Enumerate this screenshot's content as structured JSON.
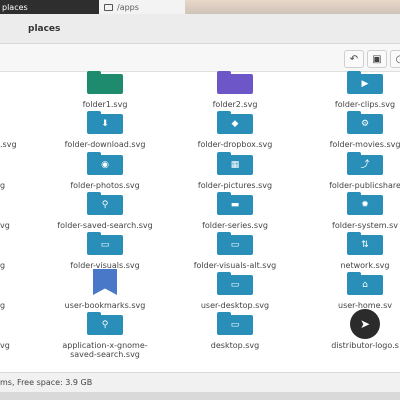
{
  "tabs": [
    {
      "label": "places"
    },
    {
      "label": "/apps"
    }
  ],
  "header": {
    "title": "places"
  },
  "toolbar": {
    "undo_icon": "undo-icon",
    "image_icon": "image-icon",
    "more_icon": "more-icon"
  },
  "items": [
    {
      "label": "folder1.svg",
      "icon": "folder-icon",
      "color": "#1e8a6e"
    },
    {
      "label": "folder2.svg",
      "icon": "folder-icon",
      "color": "#6d56c8"
    },
    {
      "label": "folder-clips.svg",
      "icon": "video-icon",
      "color": "#2a8fb8"
    },
    {
      "label": "folder-download.svg",
      "icon": "download-icon",
      "color": "#2a8fb8"
    },
    {
      "label": "folder-dropbox.svg",
      "icon": "dropbox-icon",
      "color": "#2a8fb8"
    },
    {
      "label": "folder-movies.svg",
      "icon": "film-icon",
      "color": "#2a8fb8"
    },
    {
      "label": "folder-photos.svg",
      "icon": "camera-icon",
      "color": "#2a8fb8"
    },
    {
      "label": "folder-pictures.svg",
      "icon": "picture-icon",
      "color": "#2a8fb8"
    },
    {
      "label": "folder-publicshare",
      "icon": "share-icon",
      "color": "#2a8fb8"
    },
    {
      "label": "folder-saved-search.svg",
      "icon": "search-icon",
      "color": "#2a8fb8"
    },
    {
      "label": "folder-series.svg",
      "icon": "series-icon",
      "color": "#2a8fb8"
    },
    {
      "label": "folder-system.sv",
      "icon": "gear-icon",
      "color": "#2a8fb8"
    },
    {
      "label": "folder-visuals.svg",
      "icon": "visuals-icon",
      "color": "#2a8fb8"
    },
    {
      "label": "folder-visuals-alt.svg",
      "icon": "visuals-alt-icon",
      "color": "#2a8fb8"
    },
    {
      "label": "network.svg",
      "icon": "network-icon",
      "color": "#2a8fb8"
    },
    {
      "label": "user-bookmarks.svg",
      "icon": "bookmark-icon",
      "color": "#4a78c8"
    },
    {
      "label": "user-desktop.svg",
      "icon": "desktop-icon",
      "color": "#2a8fb8"
    },
    {
      "label": "user-home.sv",
      "icon": "home-icon",
      "color": "#2a8fb8"
    },
    {
      "label": "application-x-gnome-saved-search.svg",
      "icon": "search-icon",
      "color": "#2a8fb8"
    },
    {
      "label": "desktop.svg",
      "icon": "desktop-icon",
      "color": "#2a8fb8"
    },
    {
      "label": "distributor-logo.s",
      "icon": "distributor-logo-icon",
      "color": "#2b2b2b"
    }
  ],
  "left_partial_labels": [
    ".svg",
    "g",
    "vg",
    "g",
    "g",
    "vg"
  ],
  "status": {
    "text": "ms, Free space: 3.9 GB"
  }
}
